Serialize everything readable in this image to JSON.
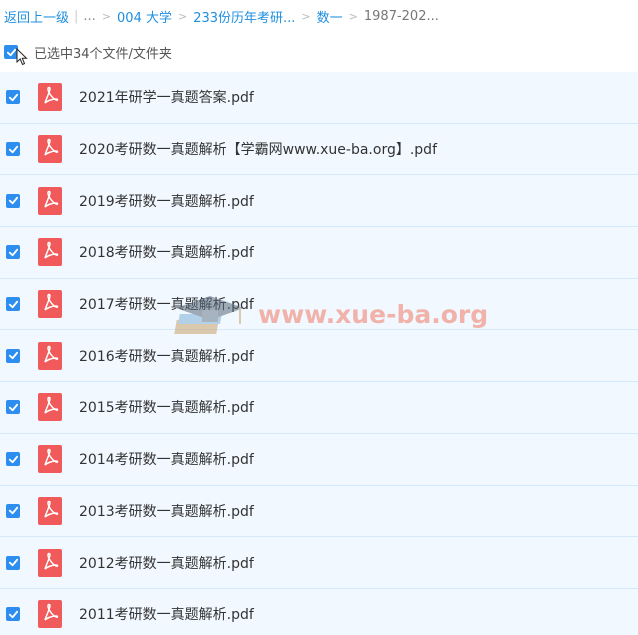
{
  "breadcrumb": {
    "back": "返回上一级",
    "ellipsis": "...",
    "items": [
      "004 大学",
      "233份历年考研...",
      "数一"
    ],
    "current": "1987-202..."
  },
  "selection": {
    "label": "已选中34个文件/文件夹"
  },
  "files": [
    {
      "name": "2021年研学一真题答案.pdf",
      "checked": true
    },
    {
      "name": "2020考研数一真题解析【学霸网www.xue-ba.org】.pdf",
      "checked": true
    },
    {
      "name": "2019考研数一真题解析.pdf",
      "checked": true
    },
    {
      "name": "2018考研数一真题解析.pdf",
      "checked": true
    },
    {
      "name": "2017考研数一真题解析.pdf",
      "checked": true
    },
    {
      "name": "2016考研数一真题解析.pdf",
      "checked": true
    },
    {
      "name": "2015考研数一真题解析.pdf",
      "checked": true
    },
    {
      "name": "2014考研数一真题解析.pdf",
      "checked": true
    },
    {
      "name": "2013考研数一真题解析.pdf",
      "checked": true
    },
    {
      "name": "2012考研数一真题解析.pdf",
      "checked": true
    },
    {
      "name": "2011考研数一真题解析.pdf",
      "checked": true
    }
  ],
  "watermark": {
    "text": "www.xue-ba.org"
  },
  "colors": {
    "accent": "#2d8ef0",
    "link": "#1e8fe0",
    "row_bg": "#f1f8ff",
    "row_border": "#d4e9fb",
    "pdf_red": "#f05a5a"
  },
  "icons": {
    "checkbox": "checkbox-checked-icon",
    "file": "pdf-file-icon",
    "cursor": "mouse-cursor-icon"
  }
}
